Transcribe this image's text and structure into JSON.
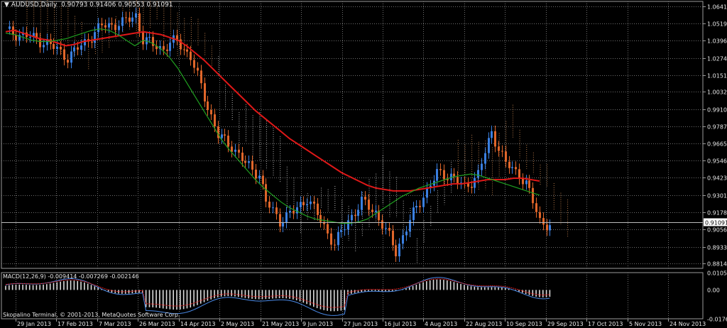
{
  "header": {
    "symbol": "AUDUSD,Daily",
    "ohlc": "0.90793 0.91406 0.90553 0.91091"
  },
  "macd": {
    "label": "MACD(12,26,9)",
    "values": "-0.009414 -0.007269 -0.002146"
  },
  "copyright": "Skopalino Terminal, © 2001-2013, MetaQuotes Software Corp.",
  "colors": {
    "background": "#000000",
    "grid": "#6e6e6e",
    "bull": "#3a7fe0",
    "bear": "#e0662a",
    "ma_red": "#e01818",
    "ma_green": "#20a020",
    "cloud_light": "#f0f0f0",
    "cloud_orange": "#f0a060",
    "macd_hist": "#dcdcdc",
    "macd_blue": "#4a8ae8",
    "macd_red": "#e02020",
    "signal_green": "#30e030"
  },
  "chart_data": {
    "type": "line",
    "title": "AUDUSD,Daily",
    "price_ticks": [
      "1.06415",
      "1.05190",
      "1.03965",
      "1.02740",
      "1.01515",
      "1.00325",
      "0.99100",
      "0.97875",
      "0.96650",
      "0.95460",
      "0.94235",
      "0.93010",
      "0.91785",
      "0.90560",
      "0.89335",
      "0.88145"
    ],
    "current_price": "0.91091",
    "ylim": [
      0.878,
      1.0675
    ],
    "x_labels": [
      "29 Jan 2013",
      "17 Feb 2013",
      "7 Mar 2013",
      "26 Mar 2013",
      "14 Apr 2013",
      "2 May 2013",
      "21 May 2013",
      "9 Jun 2013",
      "27 Jun 2013",
      "16 Jul 2013",
      "4 Aug 2013",
      "22 Aug 2013",
      "10 Sep 2013",
      "29 Sep 2013",
      "17 Oct 2013",
      "5 Nov 2013",
      "24 Nov 2013"
    ],
    "series": [
      {
        "values": [
          1.046,
          1.047,
          1.045,
          1.043,
          1.041,
          1.04,
          1.038,
          1.036,
          1.037,
          1.039,
          1.04,
          1.041,
          1.042,
          1.043,
          1.044,
          1.045,
          1.046,
          1.045,
          1.044,
          1.042,
          1.04,
          1.036,
          1.031,
          1.026,
          1.02,
          1.014,
          1.008,
          1.002,
          0.996,
          0.99,
          0.985,
          0.98,
          0.975,
          0.97,
          0.966,
          0.962,
          0.958,
          0.954,
          0.95,
          0.946,
          0.943,
          0.94,
          0.937,
          0.935,
          0.934,
          0.933,
          0.933,
          0.933,
          0.934,
          0.935,
          0.936,
          0.937,
          0.938,
          0.938,
          0.939,
          0.94,
          0.941,
          0.941,
          0.941,
          0.942,
          0.942,
          0.941,
          0.94
        ]
      },
      {
        "values": [
          1.045,
          1.044,
          1.042,
          1.04,
          1.039,
          1.039,
          1.04,
          1.041,
          1.043,
          1.045,
          1.047,
          1.048,
          1.047,
          1.044,
          1.04,
          1.036,
          1.04,
          1.038,
          1.034,
          1.028,
          1.02,
          1.01,
          1.0,
          0.99,
          0.98,
          0.97,
          0.962,
          0.955,
          0.948,
          0.941,
          0.935,
          0.93,
          0.925,
          0.921,
          0.918,
          0.915,
          0.913,
          0.912,
          0.911,
          0.91,
          0.91,
          0.911,
          0.913,
          0.917,
          0.921,
          0.925,
          0.929,
          0.932,
          0.935,
          0.937,
          0.939,
          0.941,
          0.943,
          0.944,
          0.945,
          0.944,
          0.942,
          0.94,
          0.938,
          0.936,
          0.934,
          0.932,
          0.93
        ]
      }
    ],
    "macd": {
      "ylim": [
        -0.0175,
        0.0105
      ],
      "ticks": [
        "0.010535",
        "0.00",
        "-0.017650"
      ]
    }
  }
}
